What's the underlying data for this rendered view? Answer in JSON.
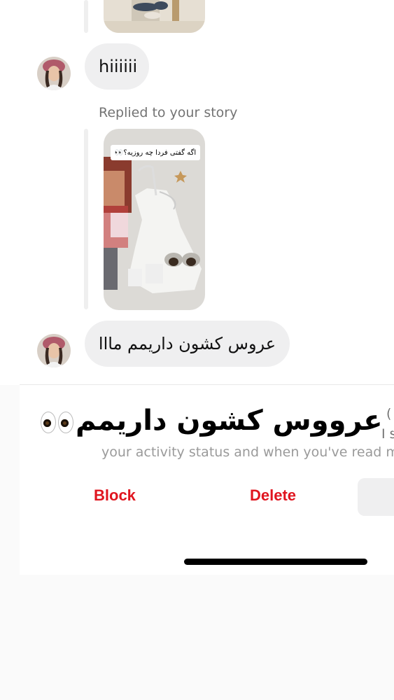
{
  "thread": {
    "messages": [
      {
        "type": "story-reply-partial"
      },
      {
        "type": "text",
        "text": "hiiiiii"
      },
      {
        "type": "story-reply",
        "label": "Replied to your story",
        "story_caption": "اگه گفتی فردا چه روزیه؟👀"
      },
      {
        "type": "text",
        "text": "عروس کشون داریمم مااا"
      }
    ]
  },
  "overlay": {
    "text": "فردا عرووس کشون داریمم"
  },
  "sheet": {
    "partial_line_1": "I s",
    "partial_line_1_paren": "(",
    "partial_line_2": "your activity status and when you've read me",
    "block_label": "Block",
    "delete_label": "Delete"
  },
  "colors": {
    "destructive": "#e0151f",
    "bubble": "#efeff0",
    "secondary_text": "#737373"
  },
  "icons": [
    "eyes-emoji-icon"
  ]
}
